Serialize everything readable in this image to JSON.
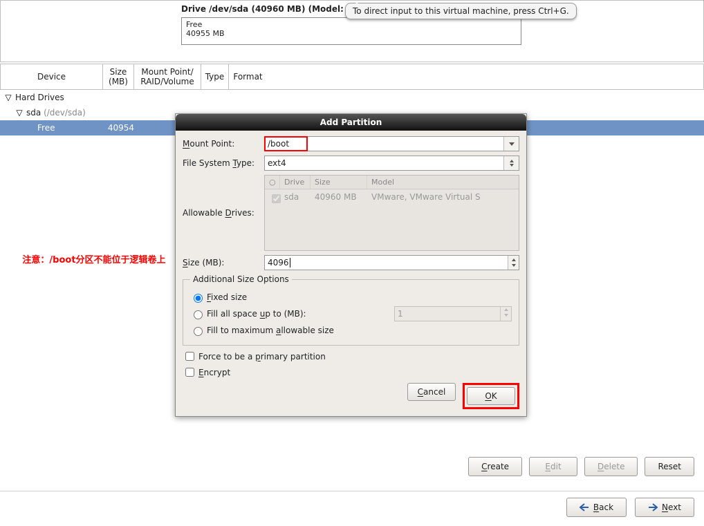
{
  "top": {
    "drive_label": "Drive /dev/sda (40960 MB) (Model:",
    "free_line1": "Free",
    "free_line2": "40955 MB"
  },
  "tooltip": "To direct input to this virtual machine, press Ctrl+G.",
  "columns": {
    "device": "Device",
    "size1": "Size",
    "size2": "(MB)",
    "mp1": "Mount Point/",
    "mp2": "RAID/Volume",
    "type": "Type",
    "format": "Format"
  },
  "tree": {
    "root": "Hard Drives",
    "sda": "sda",
    "sda_path": "(/dev/sda)",
    "free": "Free",
    "free_size": "40954"
  },
  "annotation": "注意：/boot分区不能位于逻辑卷上",
  "dialog": {
    "title": "Add Partition",
    "mount_label_pre": "M",
    "mount_label_post": "ount Point:",
    "mount_value": "/boot",
    "fstype_label_pre": "File System ",
    "fstype_label_u": "T",
    "fstype_label_post": "ype:",
    "fstype_value": "ext4",
    "drives_label_pre": "Allowable ",
    "drives_label_u": "D",
    "drives_label_post": "rives:",
    "drives_hdr_drive": "Drive",
    "drives_hdr_size": "Size",
    "drives_hdr_model": "Model",
    "drives_row_name": "sda",
    "drives_row_size": "40960 MB",
    "drives_row_model": "VMware, VMware Virtual S",
    "size_label_pre": "S",
    "size_label_post": "ize (MB):",
    "size_value": "4096",
    "opt_legend": "Additional Size Options",
    "opt_fixed_u": "F",
    "opt_fixed_post": "ixed size",
    "opt_fill_pre": "Fill all space ",
    "opt_fill_u": "u",
    "opt_fill_post": "p to (MB):",
    "opt_fill_val": "1",
    "opt_max_pre": "Fill to maximum ",
    "opt_max_u": "a",
    "opt_max_post": "llowable size",
    "chk_primary_pre": "Force to be a ",
    "chk_primary_u": "p",
    "chk_primary_post": "rimary partition",
    "chk_encrypt_u": "E",
    "chk_encrypt_post": "ncrypt",
    "cancel_u": "C",
    "cancel_post": "ancel",
    "ok_u": "O",
    "ok_post": "K"
  },
  "bottom": {
    "create_u": "C",
    "create_post": "reate",
    "edit_u": "E",
    "edit_post": "dit",
    "delete_u": "D",
    "delete_post": "elete",
    "reset": "Reset",
    "back_u": "B",
    "back_post": "ack",
    "next_u": "N",
    "next_post": "ext"
  }
}
